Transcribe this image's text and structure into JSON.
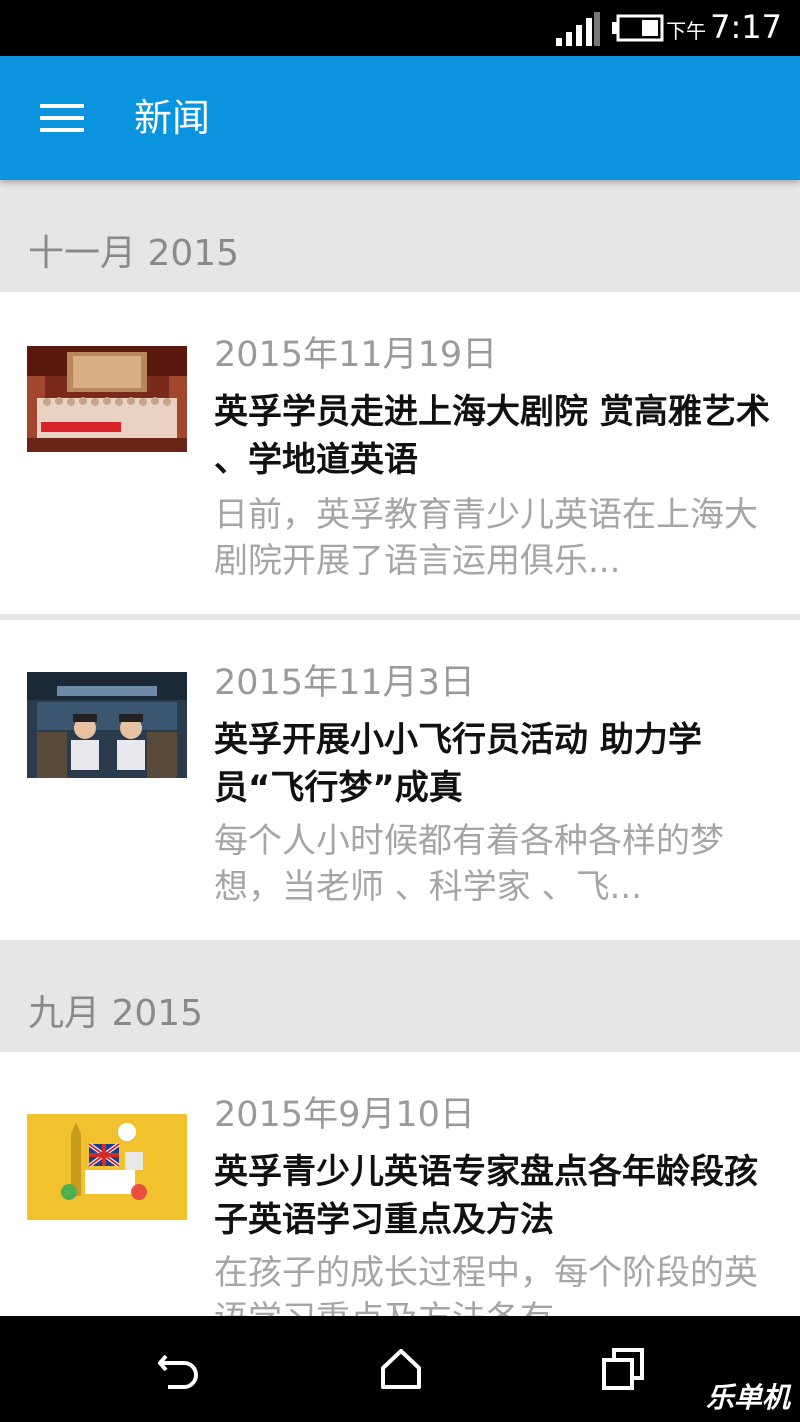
{
  "status_bar": {
    "ampm": "下午",
    "time": "7:17"
  },
  "app_bar": {
    "title": "新闻"
  },
  "sections": [
    {
      "label": "十一月 2015"
    },
    {
      "label": "九月 2015"
    }
  ],
  "news": [
    {
      "date": "2015年11月19日",
      "title": "英孚学员走进上海大剧院 赏高雅艺术 、学地道英语",
      "summary": "日前，英孚教育青少儿英语在上海大剧院开展了语言运用俱乐..."
    },
    {
      "date": "2015年11月3日",
      "title": "英孚开展小小飞行员活动 助力学员“飞行梦”成真",
      "summary": "每个人小时候都有着各种各样的梦想，当老师 、科学家 、飞..."
    },
    {
      "date": "2015年9月10日",
      "title": "英孚青少儿英语专家盘点各年龄段孩子英语学习重点及方法",
      "summary": "在孩子的成长过程中，每个阶段的英语学习重点及方法各有..."
    }
  ],
  "watermark": "乐单机",
  "colors": {
    "app_bar": "#0a93df",
    "section_bg": "#e6e6e6",
    "title_text": "#111111",
    "meta_text": "#9a9a9a"
  },
  "icons": {
    "menu": "hamburger-menu-icon",
    "signal": "cellular-signal-icon",
    "battery": "battery-icon",
    "back": "back-icon",
    "home": "home-icon",
    "recents": "recent-apps-icon"
  }
}
